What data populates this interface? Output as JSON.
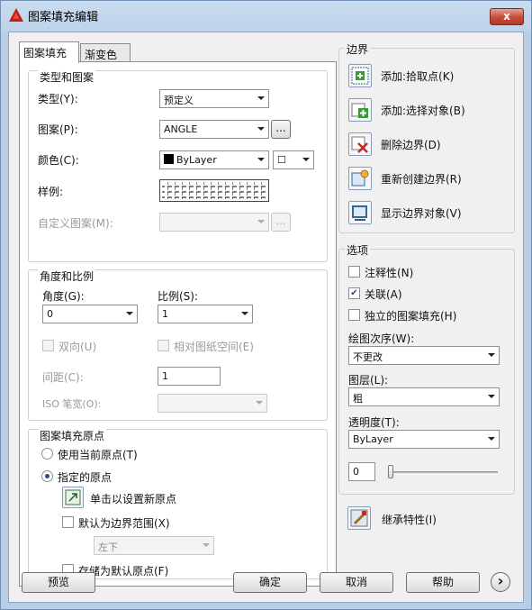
{
  "window": {
    "title": "图案填充编辑",
    "close_label": "x"
  },
  "tabs": [
    {
      "label": "图案填充",
      "active": true
    },
    {
      "label": "渐变色",
      "active": false
    }
  ],
  "type_and_pattern": {
    "title": "类型和图案",
    "type_label": "类型(Y):",
    "type_value": "预定义",
    "pattern_label": "图案(P):",
    "pattern_value": "ANGLE",
    "pattern_browse": "...",
    "color_label": "颜色(C):",
    "color_value": "ByLayer",
    "color_swatch": "#000000",
    "swatch_label": "☐",
    "sample_label": "样例:",
    "custom_label": "自定义图案(M):",
    "custom_value": "",
    "custom_browse": "..."
  },
  "angle_scale": {
    "title": "角度和比例",
    "angle_label": "角度(G):",
    "angle_value": "0",
    "scale_label": "比例(S):",
    "scale_value": "1",
    "double_label": "双向(U)",
    "relative_label": "相对图纸空间(E)",
    "spacing_label": "间距(C):",
    "spacing_value": "1",
    "iso_label": "ISO 笔宽(O):",
    "iso_value": ""
  },
  "origin": {
    "title": "图案填充原点",
    "use_current_label": "使用当前原点(T)",
    "specified_label": "指定的原点",
    "click_set_label": "单击以设置新原点",
    "default_extents_label": "默认为边界范围(X)",
    "extents_value": "左下",
    "store_default_label": "存储为默认原点(F)"
  },
  "boundaries": {
    "title": "边界",
    "add_pick_label": "添加:拾取点(K)",
    "add_select_label": "添加:选择对象(B)",
    "remove_label": "删除边界(D)",
    "recreate_label": "重新创建边界(R)",
    "view_label": "显示边界对象(V)"
  },
  "options": {
    "title": "选项",
    "annotative_label": "注释性(N)",
    "annotative_checked": false,
    "associative_label": "关联(A)",
    "associative_checked": true,
    "separate_label": "独立的图案填充(H)",
    "separate_checked": false,
    "draw_order_label": "绘图次序(W):",
    "draw_order_value": "不更改",
    "layer_label": "图层(L):",
    "layer_value": "粗",
    "transparency_label": "透明度(T):",
    "transparency_value": "ByLayer",
    "transparency_amount": "0",
    "transparency_level": 0,
    "inherit_label": "继承特性(I)"
  },
  "footer": {
    "preview_label": "预览",
    "ok_label": "确定",
    "cancel_label": "取消",
    "help_label": "帮助",
    "more_label": "›"
  }
}
